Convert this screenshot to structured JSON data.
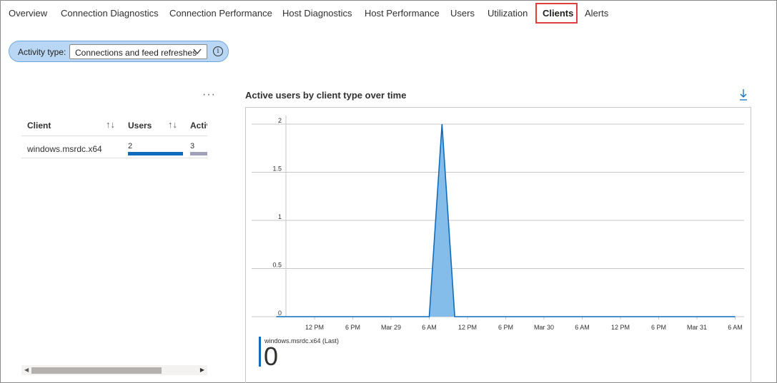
{
  "tabs": [
    {
      "label": "Overview"
    },
    {
      "label": "Connection Diagnostics"
    },
    {
      "label": "Connection Performance"
    },
    {
      "label": "Host Diagnostics"
    },
    {
      "label": "Host Performance"
    },
    {
      "label": "Users"
    },
    {
      "label": "Utilization"
    },
    {
      "label": "Clients",
      "active": true
    },
    {
      "label": "Alerts"
    }
  ],
  "filter": {
    "label": "Activity type:",
    "value": "Connections and feed refreshes"
  },
  "table": {
    "more_label": "···",
    "headers": {
      "client": "Client",
      "users": "Users",
      "activity": "Activi"
    },
    "rows": [
      {
        "client": "windows.msrdc.x64",
        "users": "2",
        "activity": "3"
      }
    ]
  },
  "chart_title": "Active users by client type over time",
  "colors": {
    "accent": "#0f6cbd",
    "area_fill": "#84bdea",
    "highlight": "#e0403b"
  },
  "icons": [
    "chevron-down-icon",
    "info-icon",
    "more-icon",
    "sort-icon",
    "download-icon"
  ],
  "legend": {
    "name": "windows.msrdc.x64 (Last)",
    "value": "0"
  },
  "chart_data": {
    "type": "area",
    "title": "Active users by client type over time",
    "xlabel": "",
    "ylabel": "",
    "ylim": [
      0,
      2
    ],
    "yticks": [
      "0",
      "0.5",
      "1",
      "1.5",
      "2"
    ],
    "xticks": [
      "12 PM",
      "6 PM",
      "Mar 29",
      "6 AM",
      "12 PM",
      "6 PM",
      "Mar 30",
      "6 AM",
      "12 PM",
      "6 PM",
      "Mar 31",
      "6 AM"
    ],
    "grid": true,
    "series": [
      {
        "name": "windows.msrdc.x64",
        "x": [
          "Mar 28 6 AM",
          "Mar 29 6 AM",
          "Mar 29 8 AM",
          "Mar 29 10 AM",
          "Mar 31 6 AM"
        ],
        "x_hours": [
          0,
          24,
          26,
          28,
          72
        ],
        "values": [
          0,
          0,
          2,
          0,
          0
        ]
      }
    ]
  }
}
